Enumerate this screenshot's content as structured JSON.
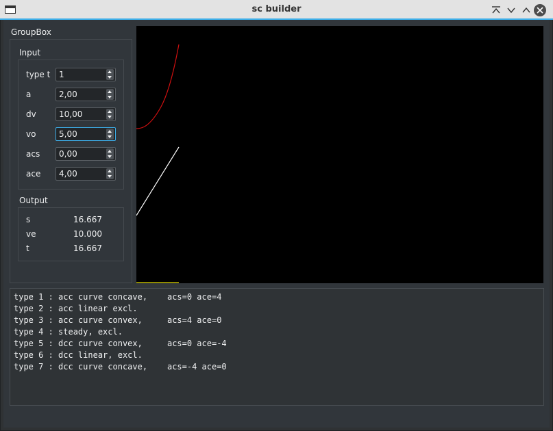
{
  "window": {
    "title": "sc builder"
  },
  "groupbox": {
    "title": "GroupBox"
  },
  "input": {
    "title": "Input",
    "fields": [
      {
        "label": "type t",
        "value": "1"
      },
      {
        "label": "a",
        "value": "2,00"
      },
      {
        "label": "dv",
        "value": "10,00"
      },
      {
        "label": "vo",
        "value": "5,00"
      },
      {
        "label": "acs",
        "value": "0,00"
      },
      {
        "label": "ace",
        "value": "4,00"
      }
    ]
  },
  "output": {
    "title": "Output",
    "rows": [
      {
        "label": "s",
        "value": "16.667"
      },
      {
        "label": "ve",
        "value": "10.000"
      },
      {
        "label": "t",
        "value": "16.667"
      }
    ]
  },
  "plot": {
    "background": "#000000",
    "curves": [
      {
        "name": "",
        "color": "#d01010"
      },
      {
        "name": "",
        "color": "#ffffff"
      },
      {
        "name": "",
        "color": "#e8e000"
      }
    ]
  },
  "console": {
    "lines": [
      "type 1 : acc curve concave,    acs=0 ace=4",
      "type 2 : acc linear excl.",
      "type 3 : acc curve convex,     acs=4 ace=0",
      "type 4 : steady, excl.",
      "type 5 : dcc curve convex,     acs=0 ace=-4",
      "type 6 : dcc linear, excl.",
      "type 7 : dcc curve concave,    acs=-4 ace=0"
    ]
  },
  "icons": {
    "keep_above": "keep-above-icon",
    "minimize": "minimize-icon",
    "maximize": "maximize-icon",
    "close": "close-icon"
  }
}
